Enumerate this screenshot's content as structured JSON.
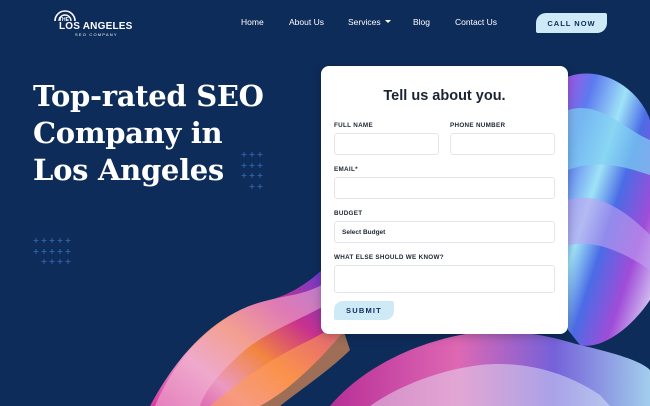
{
  "colors": {
    "background": "#0e2c5a",
    "accent": "#cfeaf7",
    "text_dark": "#1c2433",
    "plus_marks": "#3f76c6"
  },
  "logo": {
    "prefix": "THE",
    "name": "LOS ANGELES",
    "tagline": "SEO COMPANY"
  },
  "nav": {
    "items": [
      {
        "label": "Home"
      },
      {
        "label": "About Us"
      },
      {
        "label": "Services",
        "has_dropdown": true
      },
      {
        "label": "Blog"
      },
      {
        "label": "Contact Us"
      }
    ],
    "cta_label": "CALL NOW"
  },
  "hero": {
    "title_lines": [
      "Top-rated SEO",
      "Company in",
      "Los Angeles"
    ]
  },
  "form": {
    "title": "Tell us about you.",
    "full_name_label": "FULL NAME",
    "full_name_value": "",
    "phone_label": "PHONE NUMBER",
    "phone_value": "",
    "email_label": "EMAIL*",
    "email_value": "",
    "budget_label": "BUDGET",
    "budget_selected": "Select Budget",
    "notes_label": "WHAT ELSE SHOULD WE KNOW?",
    "notes_value": "",
    "submit_label": "SUBMIT"
  }
}
